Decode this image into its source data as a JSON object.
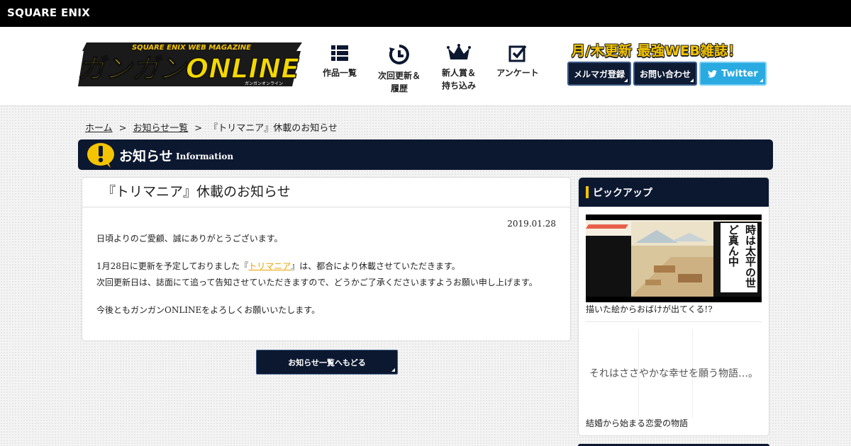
{
  "corp": {
    "logo_text": "SQUARE ENIX"
  },
  "site": {
    "logo_top": "SQUARE ENIX WEB MAGAZINE",
    "logo_main": "ガンガンONLINE",
    "logo_ruby": "ガンガンオンライン"
  },
  "nav": [
    {
      "label": "作品一覧",
      "icon": "list-grid-icon"
    },
    {
      "label": "次回更新＆\n履歴",
      "icon": "clock-refresh-icon"
    },
    {
      "label": "新人賞＆\n持ち込み",
      "icon": "crown-icon"
    },
    {
      "label": "アンケート",
      "icon": "checkbox-icon"
    }
  ],
  "header": {
    "tagline": "月/木更新 最強WEB雑誌！",
    "mailmag_label": "メルマガ登録",
    "contact_label": "お問い合わせ",
    "twitter_label": "Twitter"
  },
  "breadcrumb": {
    "home": "ホーム",
    "sep": ">",
    "list": "お知らせ一覧",
    "current": "『トリマニア』休載のお知らせ"
  },
  "section": {
    "title": "お知らせ",
    "subtitle": "Information"
  },
  "article": {
    "title": "『トリマニア』休載のお知らせ",
    "date": "2019.01.28",
    "p1": "日頃よりのご愛顧、誠にありがとうございます。",
    "p2_pre": "1月28日に更新を予定しておりました『",
    "p2_link": "トリマニア",
    "p2_post": "』は、都合により休載させていただきます。",
    "p3": "次回更新日は、誌面にて追って告知させていただきますので、どうかご了承くださいますようお願い申し上げます。",
    "p4": "今後ともガンガンONLINEをよろしくお願いいたします。"
  },
  "back_button": "お知らせ一覧へもどる",
  "sidebar": {
    "title": "ピックアップ",
    "item1_overlay": "時は太平の世",
    "item1_overlay2": "ど真ん中",
    "item1_caption": "描いた絵からおばけが出てくる!?",
    "item2_text": "それはささやかな幸せを願う物語…。",
    "item2_caption": "結婚から始まる恋愛の物語"
  },
  "colors": {
    "navy": "#0c1830",
    "accent_yellow": "#f4c400",
    "twitter": "#29aae1",
    "link": "#e8a300"
  }
}
